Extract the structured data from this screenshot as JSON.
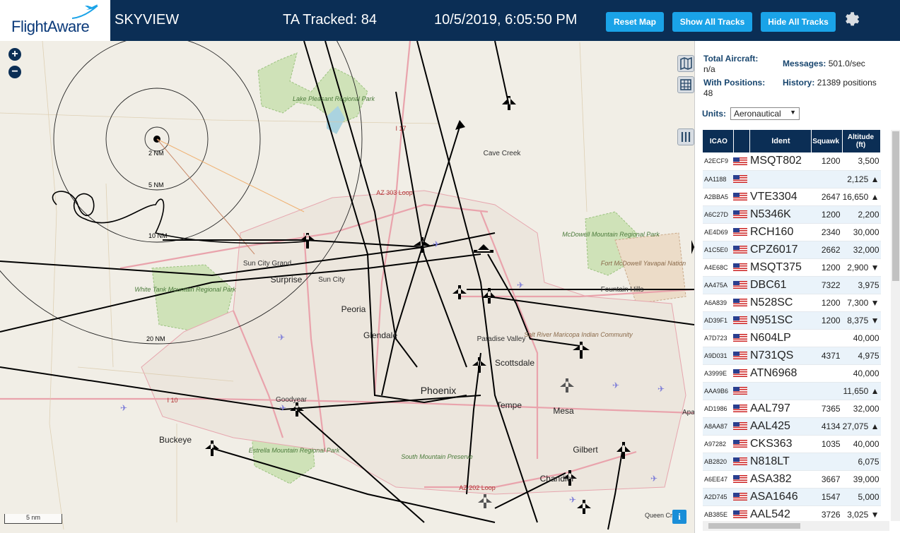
{
  "header": {
    "logo_text": "FlightAware",
    "app_title": "SKYVIEW",
    "tracked_label": "TA Tracked: 84",
    "datetime": "10/5/2019, 6:05:50 PM",
    "buttons": {
      "reset": "Reset Map",
      "show_all": "Show All Tracks",
      "hide_all": "Hide All Tracks"
    },
    "settings_icon": "gear-icon"
  },
  "map": {
    "zoom_in": "+",
    "zoom_out": "−",
    "scale_label": "5 nm",
    "info_label": "i",
    "range_rings": [
      "2 NM",
      "5 NM",
      "10 NM",
      "20 NM"
    ],
    "places": [
      {
        "name": "Lake Pleasant Regional Park",
        "kind": "park"
      },
      {
        "name": "Cave Creek",
        "kind": "town"
      },
      {
        "name": "AZ 303 Loop",
        "kind": "road"
      },
      {
        "name": "I 17",
        "kind": "road"
      },
      {
        "name": "McDowell Mountain Regional Park",
        "kind": "park"
      },
      {
        "name": "Fort McDowell Yavapai Nation",
        "kind": "reserve"
      },
      {
        "name": "Fountain Hills",
        "kind": "town"
      },
      {
        "name": "Sun City Grand",
        "kind": "town"
      },
      {
        "name": "Surprise",
        "kind": "town"
      },
      {
        "name": "Sun City",
        "kind": "town"
      },
      {
        "name": "White Tank Mountain Regional Park",
        "kind": "park"
      },
      {
        "name": "Peoria",
        "kind": "town"
      },
      {
        "name": "Glendale",
        "kind": "town"
      },
      {
        "name": "Paradise Valley",
        "kind": "town"
      },
      {
        "name": "Salt River Maricopa Indian Community",
        "kind": "reserve"
      },
      {
        "name": "Scottsdale",
        "kind": "town"
      },
      {
        "name": "Phoenix",
        "kind": "city"
      },
      {
        "name": "Tempe",
        "kind": "town"
      },
      {
        "name": "Mesa",
        "kind": "town"
      },
      {
        "name": "I 10",
        "kind": "road"
      },
      {
        "name": "Goodyear",
        "kind": "town"
      },
      {
        "name": "Buckeye",
        "kind": "town"
      },
      {
        "name": "Estrella Mountain Regional Park",
        "kind": "park"
      },
      {
        "name": "South Mountain Preserve",
        "kind": "park"
      },
      {
        "name": "Gilbert",
        "kind": "town"
      },
      {
        "name": "Chandler",
        "kind": "town"
      },
      {
        "name": "AZ 202 Loop",
        "kind": "road"
      },
      {
        "name": "Queen Cr",
        "kind": "town"
      },
      {
        "name": "Apa",
        "kind": "town"
      }
    ]
  },
  "stats": {
    "total_label": "Total Aircraft:",
    "total_value": "n/a",
    "positions_label": "With Positions:",
    "positions_value": "48",
    "messages_label": "Messages:",
    "messages_value": "501.0/sec",
    "history_label": "History:",
    "history_value": "21389 positions"
  },
  "units": {
    "label": "Units:",
    "selected": "Aeronautical"
  },
  "table": {
    "headers": {
      "icao": "ICAO",
      "ident": "Ident",
      "squawk": "Squawk",
      "altitude": "Altitude (ft)"
    },
    "rows": [
      {
        "icao": "A2ECF9",
        "ident": "MSQT802",
        "squawk": "1200",
        "altitude": "3,500"
      },
      {
        "icao": "AA1188",
        "ident": "",
        "squawk": "",
        "altitude": "2,125 ▲"
      },
      {
        "icao": "A2BBA5",
        "ident": "VTE3304",
        "squawk": "2647",
        "altitude": "16,650 ▲"
      },
      {
        "icao": "A6C27D",
        "ident": "N5346K",
        "squawk": "1200",
        "altitude": "2,200"
      },
      {
        "icao": "AE4D69",
        "ident": "RCH160",
        "squawk": "2340",
        "altitude": "30,000"
      },
      {
        "icao": "A1C5E0",
        "ident": "CPZ6017",
        "squawk": "2662",
        "altitude": "32,000"
      },
      {
        "icao": "A4E68C",
        "ident": "MSQT375",
        "squawk": "1200",
        "altitude": "2,900 ▼"
      },
      {
        "icao": "AA475A",
        "ident": "DBC61",
        "squawk": "7322",
        "altitude": "3,975"
      },
      {
        "icao": "A6A839",
        "ident": "N528SC",
        "squawk": "1200",
        "altitude": "7,300 ▼"
      },
      {
        "icao": "AD39F1",
        "ident": "N951SC",
        "squawk": "1200",
        "altitude": "8,375 ▼"
      },
      {
        "icao": "A7D723",
        "ident": "N604LP",
        "squawk": "",
        "altitude": "40,000"
      },
      {
        "icao": "A9D031",
        "ident": "N731QS",
        "squawk": "4371",
        "altitude": "4,975"
      },
      {
        "icao": "A3999E",
        "ident": "ATN6968",
        "squawk": "",
        "altitude": "40,000"
      },
      {
        "icao": "AAA9B6",
        "ident": "",
        "squawk": "",
        "altitude": "11,650 ▲"
      },
      {
        "icao": "AD1986",
        "ident": "AAL797",
        "squawk": "7365",
        "altitude": "32,000"
      },
      {
        "icao": "A8AA87",
        "ident": "AAL425",
        "squawk": "4134",
        "altitude": "27,075 ▲"
      },
      {
        "icao": "A97282",
        "ident": "CKS363",
        "squawk": "1035",
        "altitude": "40,000"
      },
      {
        "icao": "AB2820",
        "ident": "N818LT",
        "squawk": "",
        "altitude": "6,075"
      },
      {
        "icao": "A6EE47",
        "ident": "ASA382",
        "squawk": "3667",
        "altitude": "39,000"
      },
      {
        "icao": "A2D745",
        "ident": "ASA1646",
        "squawk": "1547",
        "altitude": "5,000"
      },
      {
        "icao": "AB385E",
        "ident": "AAL542",
        "squawk": "3726",
        "altitude": "3,025 ▼"
      }
    ]
  }
}
